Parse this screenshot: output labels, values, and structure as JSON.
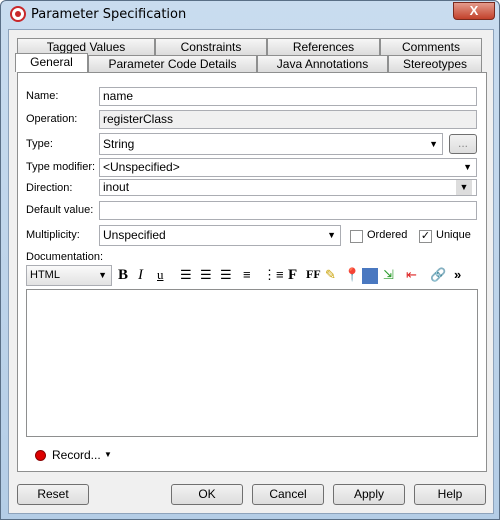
{
  "window": {
    "title": "Parameter Specification",
    "close": "X"
  },
  "tabs_back": [
    "Tagged Values",
    "Constraints",
    "References",
    "Comments"
  ],
  "tabs_front": [
    "General",
    "Parameter Code Details",
    "Java Annotations",
    "Stereotypes"
  ],
  "selected_tab": "General",
  "form": {
    "name_label": "Name:",
    "name_value": "name",
    "operation_label": "Operation:",
    "operation_value": "registerClass",
    "type_label": "Type:",
    "type_value": "String",
    "type_browse": "...",
    "type_modifier_label": "Type modifier:",
    "type_modifier_value": "<Unspecified>",
    "direction_label": "Direction:",
    "direction_value": "inout",
    "default_label": "Default value:",
    "default_value": "",
    "multiplicity_label": "Multiplicity:",
    "multiplicity_value": "Unspecified",
    "ordered_label": "Ordered",
    "ordered_checked": false,
    "unique_label": "Unique",
    "unique_checked": true,
    "documentation_label": "Documentation:"
  },
  "doc_toolbar": {
    "format": "HTML",
    "bold": "B",
    "italic": "I",
    "underline": "u",
    "font": "F",
    "font_size": "FF",
    "more": "»"
  },
  "record": "Record...",
  "buttons": {
    "reset": "Reset",
    "ok": "OK",
    "cancel": "Cancel",
    "apply": "Apply",
    "help": "Help"
  }
}
